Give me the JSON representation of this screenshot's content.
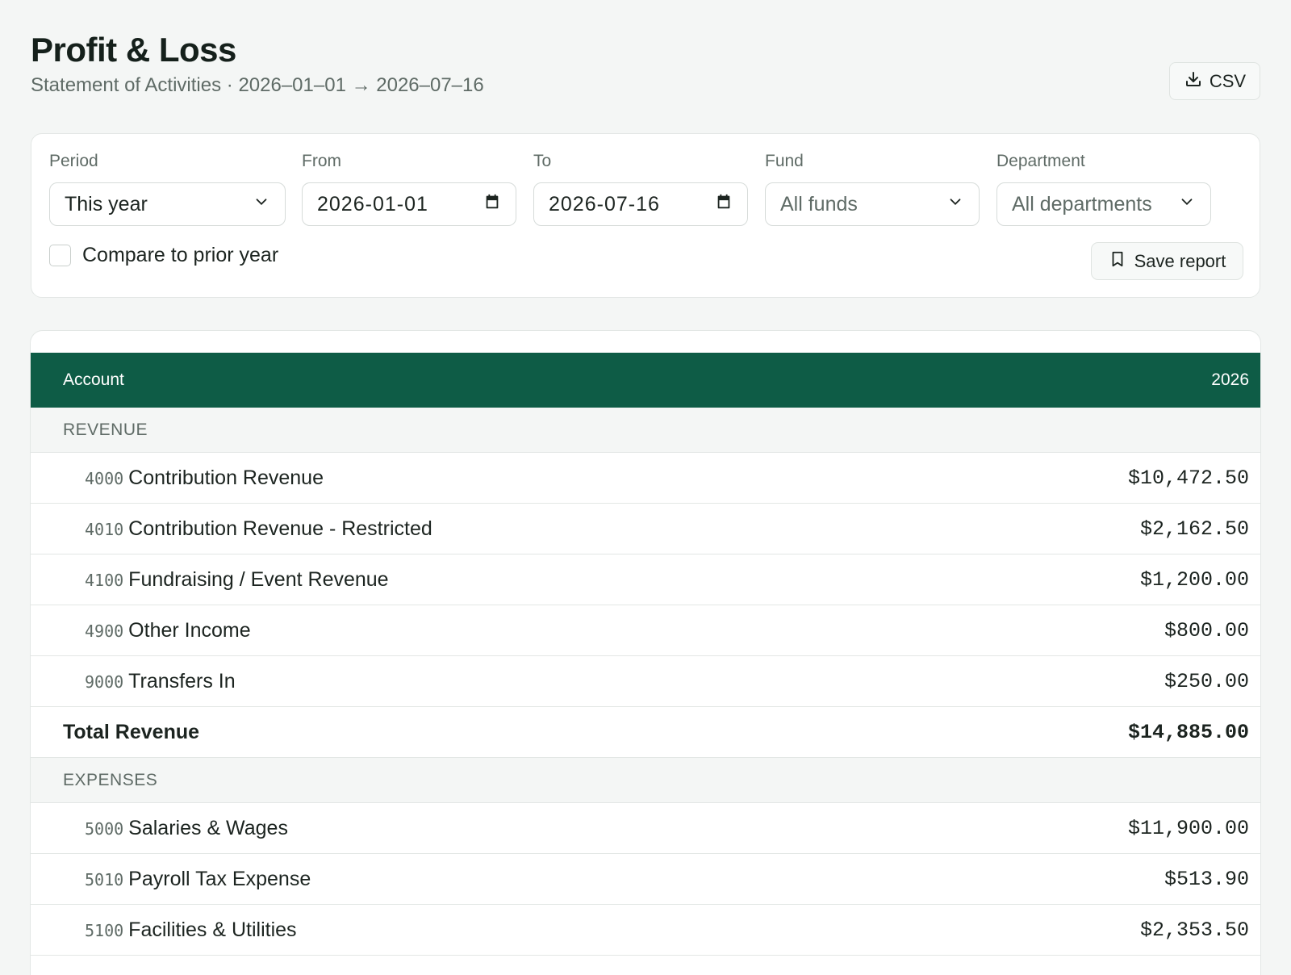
{
  "header": {
    "title": "Profit & Loss",
    "subtitle": "Statement of Activities · 2026–01–01 → 2026–07–16",
    "csv_label": "CSV"
  },
  "filters": {
    "period": {
      "label": "Period",
      "value": "This year"
    },
    "from": {
      "label": "From",
      "value": "2026-01-01"
    },
    "to": {
      "label": "To",
      "value": "2026-07-16"
    },
    "fund": {
      "label": "Fund",
      "value": "All funds"
    },
    "department": {
      "label": "Department",
      "value": "All departments"
    },
    "compare": {
      "label": "Compare to prior year",
      "checked": false
    },
    "save_label": "Save report"
  },
  "table": {
    "col_account": "Account",
    "col_year": "2026",
    "revenue_section": "REVENUE",
    "revenue_rows": [
      {
        "code": "4000",
        "name": "Contribution Revenue",
        "amount": "$10,472.50"
      },
      {
        "code": "4010",
        "name": "Contribution Revenue - Restricted",
        "amount": "$2,162.50"
      },
      {
        "code": "4100",
        "name": "Fundraising / Event Revenue",
        "amount": "$1,200.00"
      },
      {
        "code": "4900",
        "name": "Other Income",
        "amount": "$800.00"
      },
      {
        "code": "9000",
        "name": "Transfers In",
        "amount": "$250.00"
      }
    ],
    "total_revenue": {
      "label": "Total Revenue",
      "amount": "$14,885.00"
    },
    "expenses_section": "EXPENSES",
    "expense_rows": [
      {
        "code": "5000",
        "name": "Salaries & Wages",
        "amount": "$11,900.00"
      },
      {
        "code": "5010",
        "name": "Payroll Tax Expense",
        "amount": "$513.90"
      },
      {
        "code": "5100",
        "name": "Facilities & Utilities",
        "amount": "$2,353.50"
      }
    ]
  },
  "colors": {
    "accent": "#0e5c46",
    "background": "#f4f6f5"
  }
}
